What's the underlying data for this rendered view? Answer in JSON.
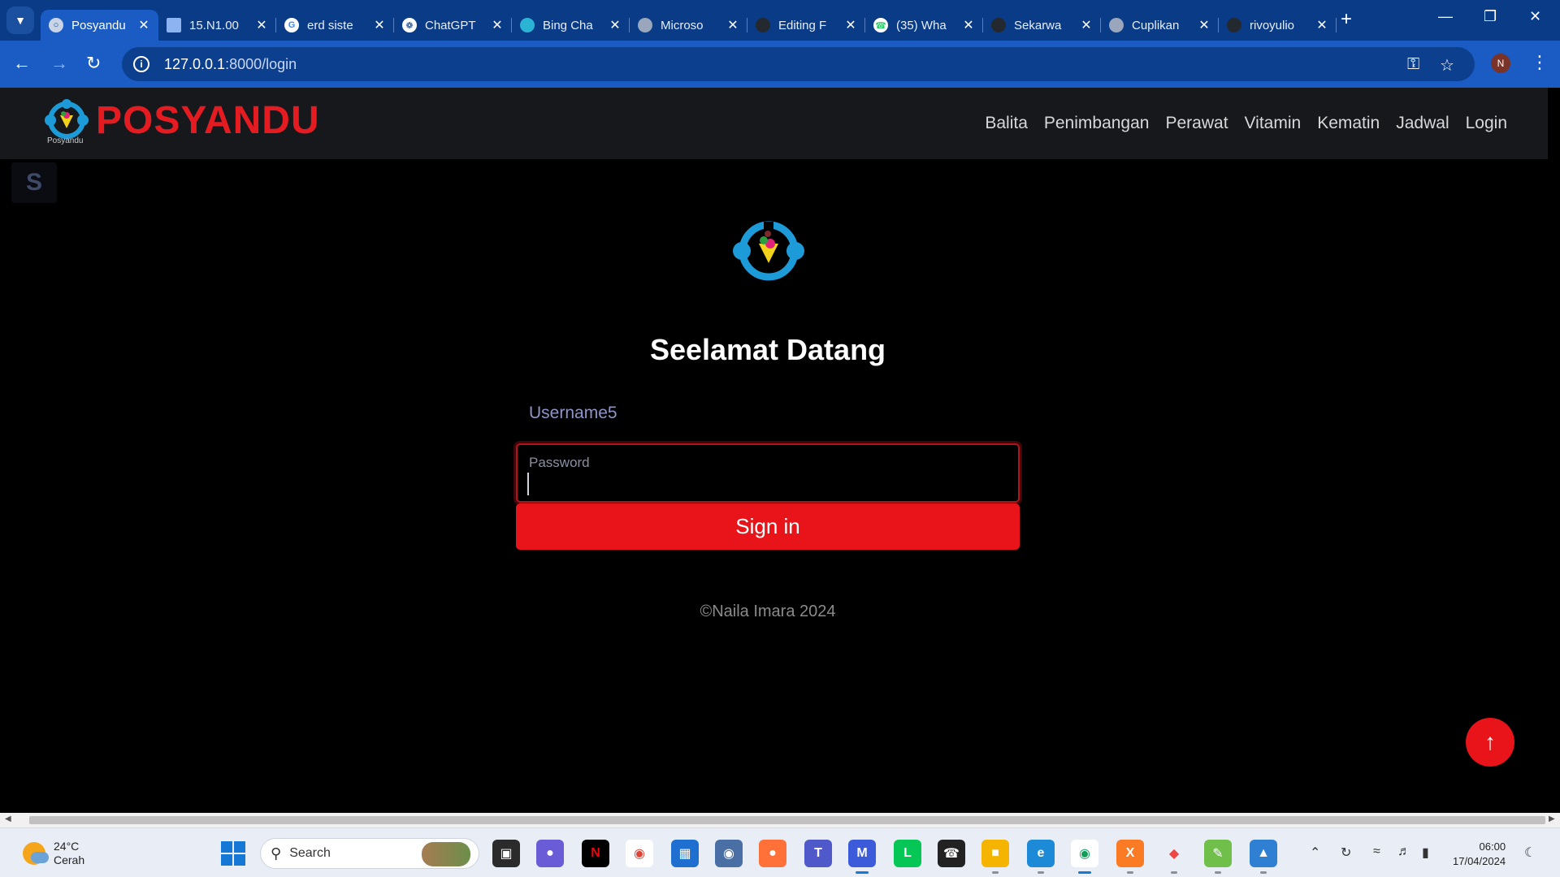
{
  "browser": {
    "tabs": [
      {
        "title": "Posyandu",
        "active": true
      },
      {
        "title": "15.N1.00",
        "active": false
      },
      {
        "title": "erd siste",
        "active": false
      },
      {
        "title": "ChatGPT",
        "active": false
      },
      {
        "title": "Bing Cha",
        "active": false
      },
      {
        "title": "Microso",
        "active": false
      },
      {
        "title": "Editing F",
        "active": false
      },
      {
        "title": "(35) Wha",
        "active": false
      },
      {
        "title": "Sekarwa",
        "active": false
      },
      {
        "title": "Cuplikan",
        "active": false
      },
      {
        "title": "rivoyulio",
        "active": false
      }
    ],
    "url_host": "127.0.0.1",
    "url_path": ":8000/login",
    "profile_initial": "N"
  },
  "site": {
    "brand": "POSYANDU",
    "brand_sub": "Posyandu",
    "menu": [
      "Balita",
      "Penimbangan",
      "Perawat",
      "Vitamin",
      "Kematin",
      "Jadwal",
      "Login"
    ]
  },
  "login": {
    "heading": "Seelamat Datang",
    "username_label": "Username5",
    "password_label": "Password",
    "password_value": "",
    "submit_label": "Sign in",
    "footer": "©Naila Imara 2024"
  },
  "taskbar": {
    "temperature": "24°C",
    "weather": "Cerah",
    "search_placeholder": "Search",
    "time": "06:00",
    "date": "17/04/2024"
  },
  "colors": {
    "accent_red": "#e8141a",
    "brand_red": "#e41c22",
    "navbar_bg": "#16181c",
    "chrome_blue": "#1a5bc4"
  }
}
